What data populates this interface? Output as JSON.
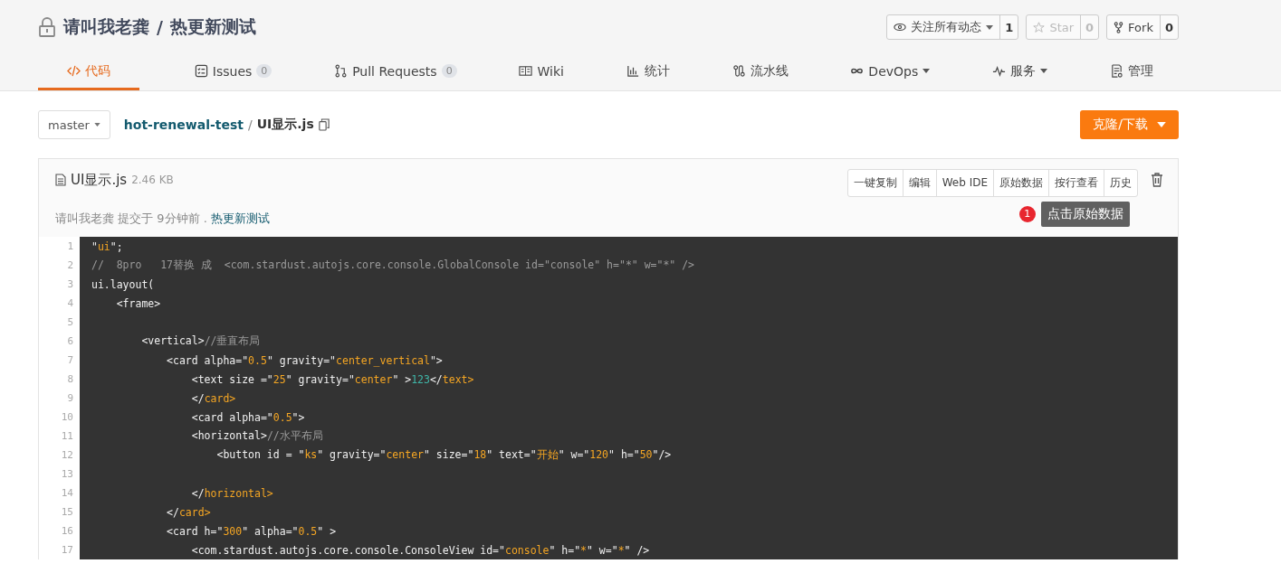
{
  "repo": {
    "owner": "请叫我老龚",
    "separator": "/",
    "name": "热更新测试",
    "private": true
  },
  "social": [
    {
      "kind": "watch",
      "label": "关注所有动态",
      "count": "1",
      "disabled": false
    },
    {
      "kind": "star",
      "label": "Star",
      "count": "0",
      "disabled": true
    },
    {
      "kind": "fork",
      "label": "Fork",
      "count": "0",
      "disabled": false
    }
  ],
  "tabs": [
    {
      "kind": "code",
      "label": "代码",
      "selected": true
    },
    {
      "kind": "issues",
      "label": "Issues",
      "badge": "0",
      "selected": false
    },
    {
      "kind": "pulls",
      "label": "Pull Requests",
      "badge": "0",
      "selected": false
    },
    {
      "kind": "wiki",
      "label": "Wiki",
      "selected": false
    },
    {
      "kind": "stats",
      "label": "统计",
      "selected": false
    },
    {
      "kind": "pipeline",
      "label": "流水线",
      "selected": false
    },
    {
      "kind": "devops",
      "label": "DevOps",
      "dropdown": true,
      "selected": false
    },
    {
      "kind": "service",
      "label": "服务",
      "dropdown": true,
      "selected": false
    },
    {
      "kind": "manage",
      "label": "管理",
      "selected": false
    }
  ],
  "branch": "master",
  "breadcrumb": {
    "repo": "hot-renewal-test",
    "separator": "/",
    "file": "UI显示.js"
  },
  "clone_button": "克隆/下载",
  "file": {
    "name": "UI显示.js",
    "size": "2.46 KB",
    "author": "请叫我老龚",
    "action": "提交于",
    "time": "9分钟前",
    "separator": ".",
    "message": "热更新测试"
  },
  "file_actions": [
    "一键复制",
    "编辑",
    "Web IDE",
    "原始数据",
    "按行查看",
    "历史"
  ],
  "tooltip": {
    "badge": "1",
    "text": "点击原始数据"
  },
  "code_lines": [
    {
      "number": "1",
      "tokens": [
        {
          "kind": "plain",
          "text": "\""
        },
        {
          "kind": "string",
          "text": "ui"
        },
        {
          "kind": "plain",
          "text": "\";"
        }
      ]
    },
    {
      "number": "2",
      "tokens": [
        {
          "kind": "comment",
          "text": "//  8pro   17替换 成  <com.stardust.autojs.core.console.GlobalConsole id=\"console\" h=\"*\" w=\"*\" />"
        }
      ]
    },
    {
      "number": "3",
      "tokens": [
        {
          "kind": "plain",
          "text": "ui.layout("
        }
      ]
    },
    {
      "number": "4",
      "tokens": [
        {
          "kind": "plain",
          "text": "    <frame>"
        }
      ]
    },
    {
      "number": "5"
    },
    {
      "number": "6",
      "tokens": [
        {
          "kind": "plain",
          "text": "        <vertical>"
        },
        {
          "kind": "comment",
          "text": "//垂直布局"
        }
      ]
    },
    {
      "number": "7",
      "tokens": [
        {
          "kind": "plain",
          "text": "            <card alpha=\""
        },
        {
          "kind": "string",
          "text": "0.5"
        },
        {
          "kind": "plain",
          "text": "\" gravity=\""
        },
        {
          "kind": "string",
          "text": "center_vertical"
        },
        {
          "kind": "plain",
          "text": "\">"
        }
      ]
    },
    {
      "number": "8",
      "tokens": [
        {
          "kind": "plain",
          "text": "                <text size =\""
        },
        {
          "kind": "string",
          "text": "25"
        },
        {
          "kind": "plain",
          "text": "\" gravity=\""
        },
        {
          "kind": "string",
          "text": "center"
        },
        {
          "kind": "plain",
          "text": "\" >"
        },
        {
          "kind": "number",
          "text": "123"
        },
        {
          "kind": "plain",
          "text": "</"
        },
        {
          "kind": "string",
          "text": "text>"
        }
      ]
    },
    {
      "number": "9",
      "tokens": [
        {
          "kind": "plain",
          "text": "                </"
        },
        {
          "kind": "string",
          "text": "card>"
        }
      ]
    },
    {
      "number": "10",
      "tokens": [
        {
          "kind": "plain",
          "text": "                <card alpha=\""
        },
        {
          "kind": "string",
          "text": "0.5"
        },
        {
          "kind": "plain",
          "text": "\">"
        }
      ]
    },
    {
      "number": "11",
      "tokens": [
        {
          "kind": "plain",
          "text": "                <horizontal>"
        },
        {
          "kind": "comment",
          "text": "//水平布局"
        }
      ]
    },
    {
      "number": "12",
      "tokens": [
        {
          "kind": "plain",
          "text": "                    <button id = \""
        },
        {
          "kind": "string",
          "text": "ks"
        },
        {
          "kind": "plain",
          "text": "\" gravity=\""
        },
        {
          "kind": "string",
          "text": "center"
        },
        {
          "kind": "plain",
          "text": "\" size=\""
        },
        {
          "kind": "string",
          "text": "18"
        },
        {
          "kind": "plain",
          "text": "\" text=\""
        },
        {
          "kind": "string",
          "text": "开始"
        },
        {
          "kind": "plain",
          "text": "\" w=\""
        },
        {
          "kind": "string",
          "text": "120"
        },
        {
          "kind": "plain",
          "text": "\" h=\""
        },
        {
          "kind": "string",
          "text": "50"
        },
        {
          "kind": "plain",
          "text": "\"/>"
        }
      ]
    },
    {
      "number": "13"
    },
    {
      "number": "14",
      "tokens": [
        {
          "kind": "plain",
          "text": "                </"
        },
        {
          "kind": "string",
          "text": "horizontal>"
        }
      ]
    },
    {
      "number": "15",
      "tokens": [
        {
          "kind": "plain",
          "text": "            </"
        },
        {
          "kind": "string",
          "text": "card>"
        }
      ]
    },
    {
      "number": "16",
      "tokens": [
        {
          "kind": "plain",
          "text": "            <card h=\""
        },
        {
          "kind": "string",
          "text": "300"
        },
        {
          "kind": "plain",
          "text": "\" alpha=\""
        },
        {
          "kind": "string",
          "text": "0.5"
        },
        {
          "kind": "plain",
          "text": "\" >"
        }
      ]
    },
    {
      "number": "17",
      "tokens": [
        {
          "kind": "plain",
          "text": "                <com.stardust.autojs.core.console.ConsoleView id=\""
        },
        {
          "kind": "string",
          "text": "console"
        },
        {
          "kind": "plain",
          "text": "\" h=\""
        },
        {
          "kind": "string",
          "text": "*"
        },
        {
          "kind": "plain",
          "text": "\" w=\""
        },
        {
          "kind": "string",
          "text": "*"
        },
        {
          "kind": "plain",
          "text": "\" />"
        }
      ]
    }
  ]
}
